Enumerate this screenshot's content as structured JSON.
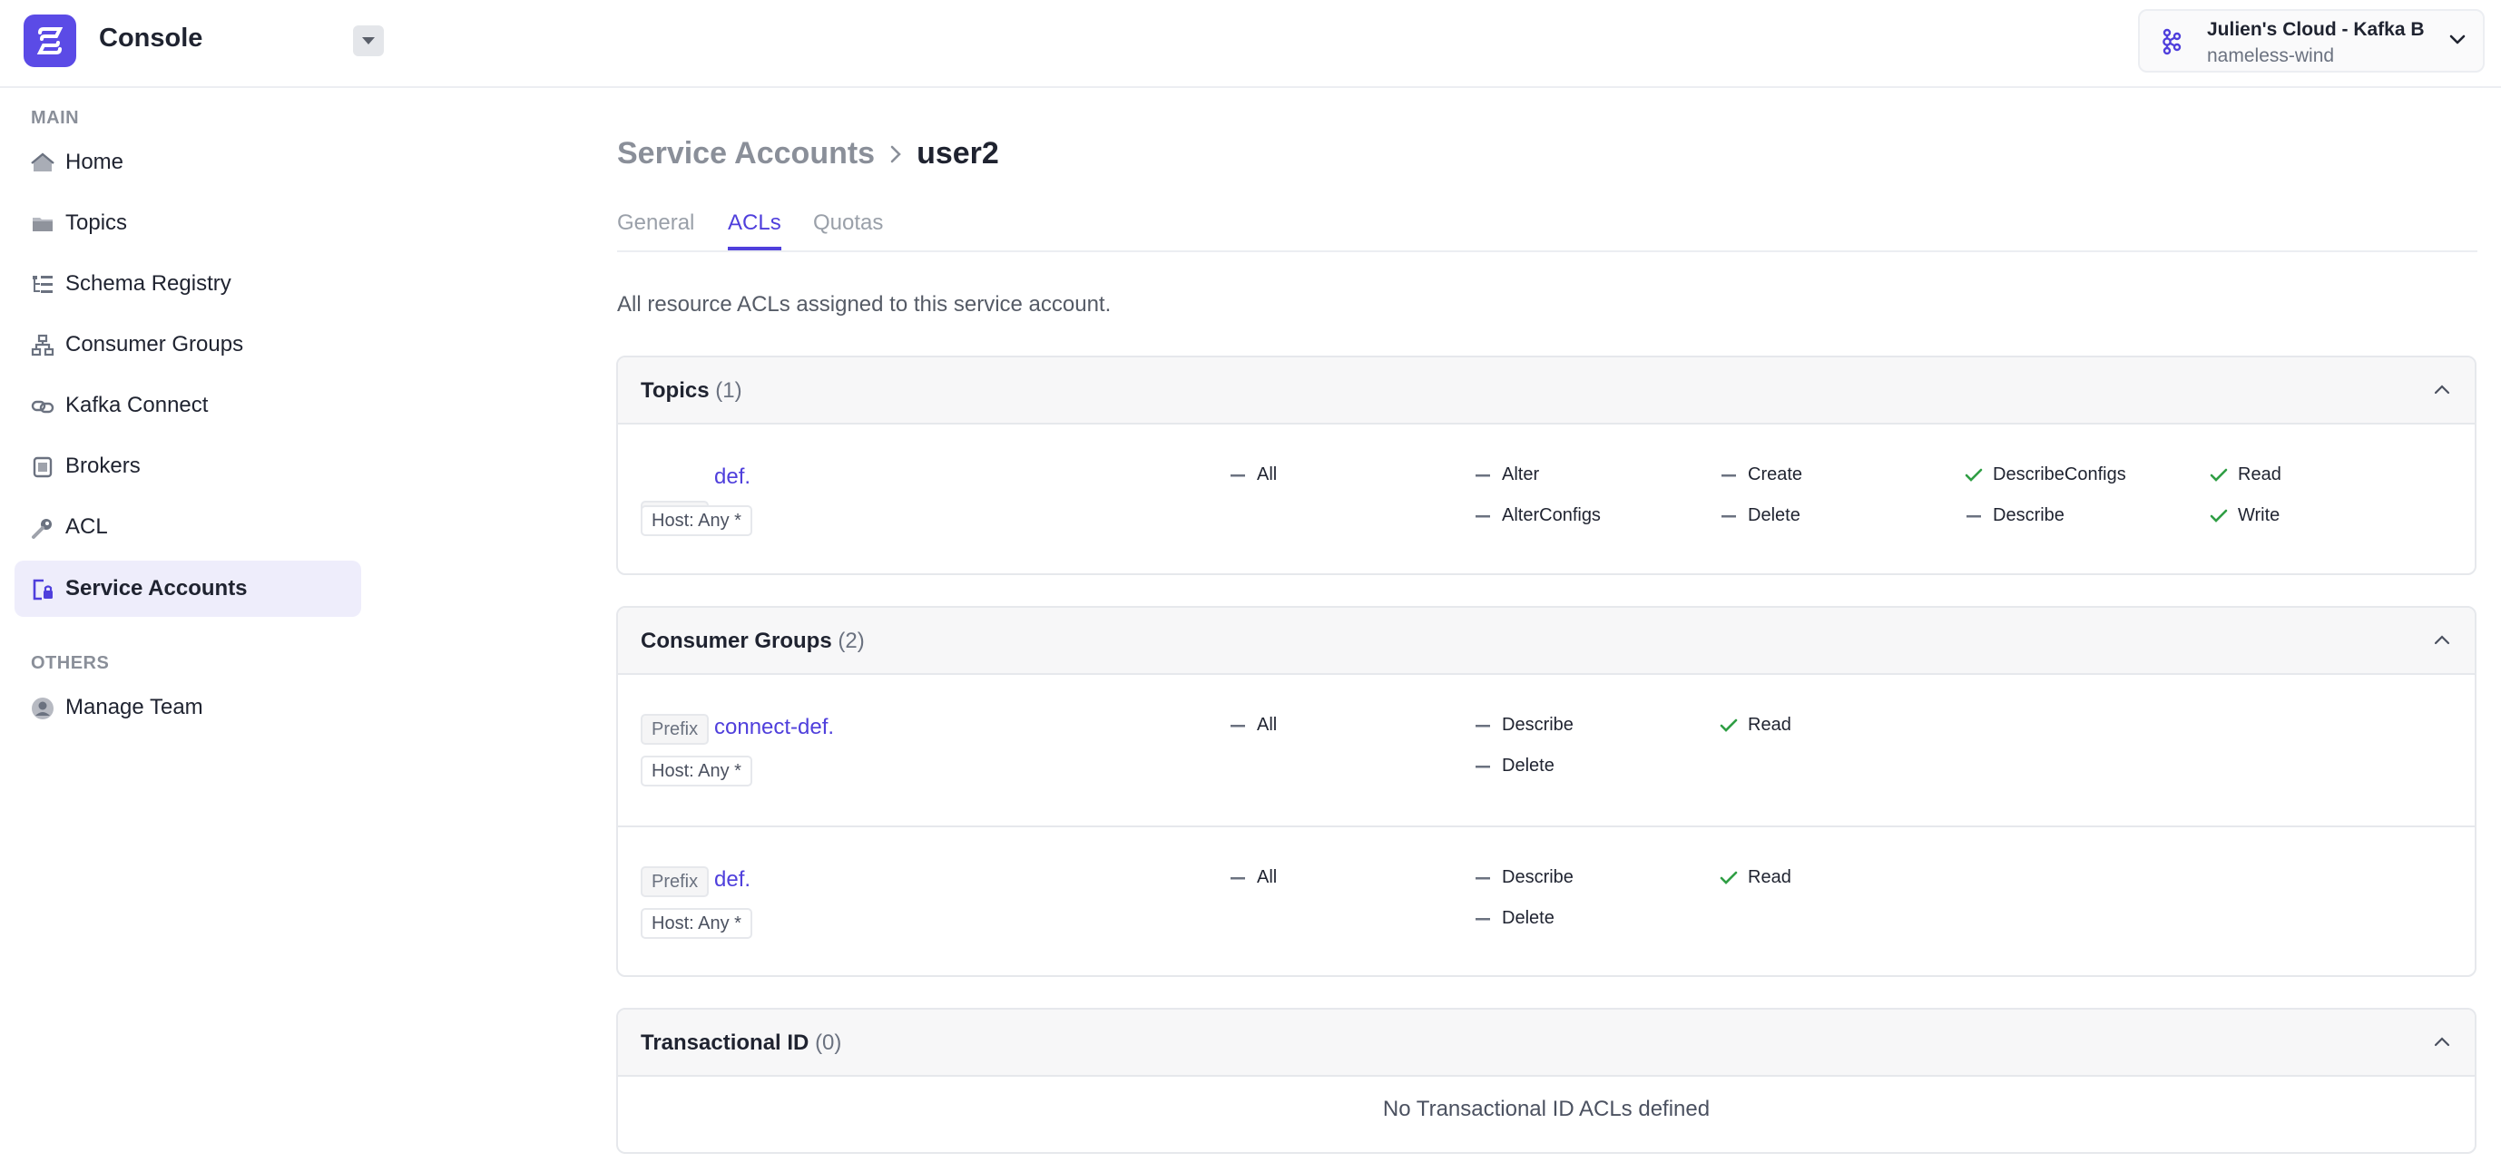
{
  "app": {
    "title": "Console"
  },
  "cluster": {
    "name": "Julien's Cloud - Kafka B",
    "env": "nameless-wind"
  },
  "sidebar": {
    "main_label": "MAIN",
    "items": [
      {
        "label": "Home",
        "icon": "home-icon"
      },
      {
        "label": "Topics",
        "icon": "folder-icon"
      },
      {
        "label": "Schema Registry",
        "icon": "tree-icon"
      },
      {
        "label": "Consumer Groups",
        "icon": "groups-icon"
      },
      {
        "label": "Kafka Connect",
        "icon": "link-icon"
      },
      {
        "label": "Brokers",
        "icon": "server-icon"
      },
      {
        "label": "ACL",
        "icon": "key-icon"
      },
      {
        "label": "Service Accounts",
        "icon": "service-account-icon",
        "active": true
      }
    ],
    "others_label": "OTHERS",
    "others": [
      {
        "label": "Manage Team",
        "icon": "user-circle-icon"
      }
    ]
  },
  "breadcrumb": {
    "parent": "Service Accounts",
    "current": "user2"
  },
  "tabs": [
    {
      "label": "General"
    },
    {
      "label": "ACLs",
      "active": true
    },
    {
      "label": "Quotas"
    }
  ],
  "description": "All resource ACLs assigned to this service account.",
  "sections": {
    "topics": {
      "title": "Topics",
      "count": "(1)",
      "rows": [
        {
          "type": "Prefix",
          "name": "def.",
          "host": "Host: Any *",
          "all": "All",
          "perms": [
            [
              "Alter",
              "AlterConfigs"
            ],
            [
              "Create",
              "Delete"
            ],
            [
              "DescribeConfigs",
              "Describe"
            ],
            [
              "Read",
              "Write"
            ]
          ]
        }
      ]
    },
    "consumer_groups": {
      "title": "Consumer Groups",
      "count": "(2)",
      "rows": [
        {
          "type": "Prefix",
          "name": "connect-def.",
          "host": "Host: Any *",
          "all": "All",
          "perms": [
            [
              "Describe",
              "Delete"
            ],
            [
              "Read"
            ]
          ]
        },
        {
          "type": "Prefix",
          "name": "def.",
          "host": "Host: Any *",
          "all": "All",
          "perms": [
            [
              "Describe",
              "Delete"
            ],
            [
              "Read"
            ]
          ]
        }
      ]
    },
    "transactional": {
      "title": "Transactional ID",
      "count": "(0)",
      "empty": "No Transactional ID ACLs defined"
    }
  },
  "colors": {
    "accent": "#4f3fdc",
    "granted": "#2f9e44",
    "denied": "#6b7280"
  }
}
